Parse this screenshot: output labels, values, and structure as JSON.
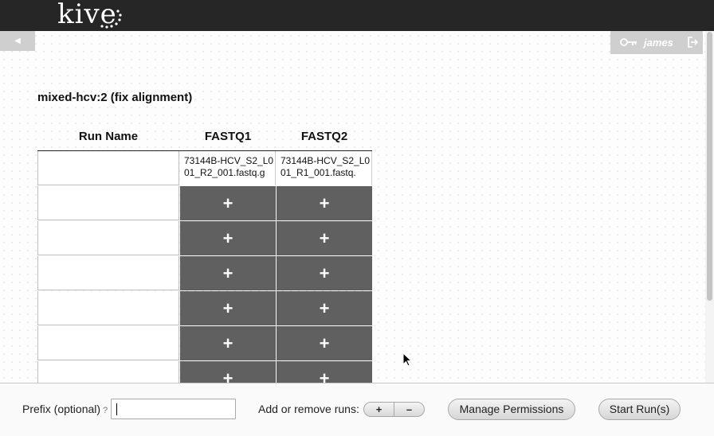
{
  "header": {
    "logo_text": "kive",
    "back_icon": "back-arrow-icon",
    "user_name": "james",
    "user_icon": "key-icon",
    "logout_icon": "logout-icon"
  },
  "page_title": "mixed-hcv:2 (fix alignment)",
  "table": {
    "headers": [
      "Run Name",
      "FASTQ1",
      "FASTQ2"
    ],
    "rows": [
      {
        "run_name": "",
        "fastq1": "73144B-HCV_S2_L001_R2_001.fastq.g",
        "fastq2": "73144B-HCV_S2_L001_R1_001.fastq."
      },
      {
        "run_name": "",
        "fastq1": "+",
        "fastq2": "+"
      },
      {
        "run_name": "",
        "fastq1": "+",
        "fastq2": "+"
      },
      {
        "run_name": "",
        "fastq1": "+",
        "fastq2": "+"
      },
      {
        "run_name": "",
        "fastq1": "+",
        "fastq2": "+"
      },
      {
        "run_name": "",
        "fastq1": "+",
        "fastq2": "+"
      },
      {
        "run_name": "",
        "fastq1": "+",
        "fastq2": "+"
      }
    ]
  },
  "footer": {
    "prefix_label": "Prefix (optional)",
    "prefix_help": "?",
    "prefix_value": "",
    "add_remove_label": "Add or remove runs:",
    "add_label": "+",
    "remove_label": "–",
    "manage_permissions_label": "Manage Permissions",
    "start_runs_label": "Start Run(s)"
  },
  "colors": {
    "topbar": "#262626",
    "add_cell": "#606060",
    "subbar": "#cfcfcf"
  }
}
